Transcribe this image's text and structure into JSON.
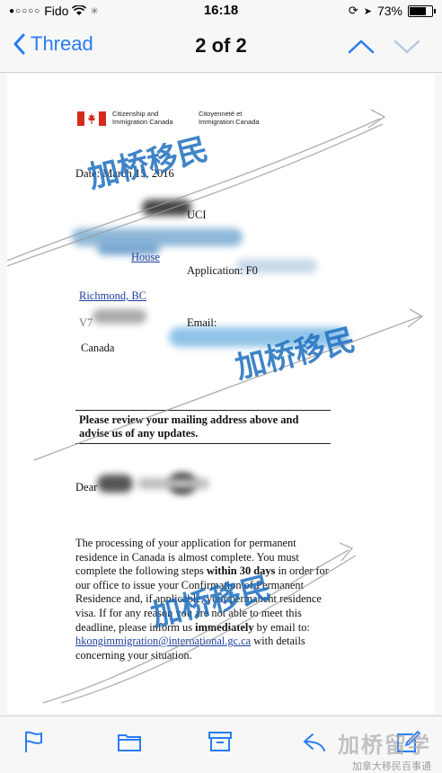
{
  "status": {
    "carrier": "Fido",
    "time": "16:18",
    "battery": "73%",
    "battery_level": 0.73
  },
  "nav": {
    "back_label": "Thread",
    "title": "2 of 2"
  },
  "letter": {
    "org_en_1": "Citizenship and",
    "org_en_2": "Immigration Canada",
    "org_fr_1": "Citoyenneté et",
    "org_fr_2": "Immigration Canada",
    "date": "Date: March 15, 2016",
    "uci_label": "UCI",
    "address_1": "House",
    "application_label": "Application: F0",
    "city": "Richmond, BC",
    "postal_prefix": "V7",
    "email_label": "Email:",
    "country": "Canada",
    "notice_line_1": "Please review your mailing address above and",
    "notice_line_2": "advise us of any updates.",
    "salutation": "Dear",
    "para_1": "The processing of your application for permanent residence in Canada is almost complete. You must complete the following steps ",
    "para_bold_1": "within 30 days",
    "para_2": " in order for our office to issue your Confirmation of Permanent Residence and, if applicable, your permanent residence visa. If for any reason you are not able to meet this deadline, please inform us ",
    "para_bold_2": "immediately",
    "para_3": " by email to:",
    "email_link": "hkongimmigration@international.gc.ca",
    "para_4": " with details concerning your situation."
  },
  "watermarks": {
    "stamp_1": "加桥移民",
    "stamp_2": "加桥移民",
    "stamp_3": "加桥移民",
    "corner_big": "加桥留学",
    "corner_small": "加拿大移民百事通"
  },
  "toolbar": {
    "icons": [
      "flag-icon",
      "folder-icon",
      "archive-icon",
      "reply-icon",
      "compose-icon"
    ]
  },
  "colors": {
    "accent": "#2a7cf2",
    "watermark": "#1e6ebe",
    "flag_red": "#d52b1e"
  }
}
